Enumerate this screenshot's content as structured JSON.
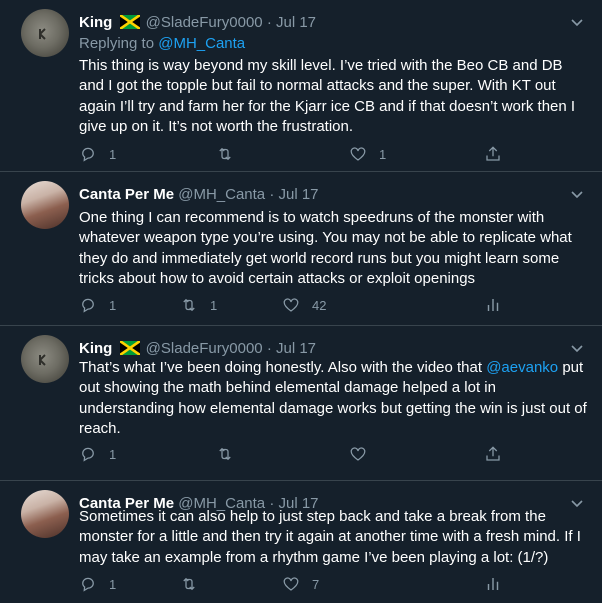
{
  "tweets": [
    {
      "name": "King",
      "handle": "@SladeFury0000",
      "dot": "·",
      "date": "Jul 17",
      "replying_prefix": "Replying to ",
      "replying_to": "@MH_Canta",
      "text": "This thing is way beyond my skill level. I’ve tried with the Beo CB and DB and I got the topple but fail to normal attacks and the super. With KT out again I’ll try and farm her for the Kjarr ice CB and if that doesn’t work then I give up on it. It’s not worth the frustration.",
      "replies": "1",
      "retweets": "",
      "likes": "1",
      "last_action": "share-icon"
    },
    {
      "name": "Canta Per Me",
      "handle": "@MH_Canta",
      "dot": "·",
      "date": "Jul 17",
      "text": "One thing I can recommend is to watch speedruns of the monster with whatever weapon type you’re using. You may not be able to replicate what they do and immediately get world record runs but you might learn some tricks about how to avoid certain attacks or exploit openings",
      "replies": "1",
      "retweets": "1",
      "likes": "42",
      "last_action": "analytics-icon"
    },
    {
      "name": "King",
      "handle": "@SladeFury0000",
      "dot": "·",
      "date": "Jul 17",
      "text_before": "That’s what I’ve been doing honestly. Also with the video that ",
      "mention": "@aevanko",
      "text_after": " put out showing the math behind elemental damage helped a lot in understanding how elemental damage works but getting the win is just out of reach.",
      "replies": "1",
      "retweets": "",
      "likes": "",
      "last_action": "share-icon"
    },
    {
      "name": "Canta Per Me",
      "handle": "@MH_Canta",
      "dot": "·",
      "date": "Jul 17",
      "text": "Sometimes it can also help to just step back and take a break from the monster for a little and then try it again at another time with a fresh mind. If I may take an example from a rhythm game I’ve been playing a lot: (1/?)",
      "replies": "1",
      "retweets": "",
      "likes": "7",
      "last_action": "analytics-icon"
    }
  ],
  "colors": {
    "background": "#15202b",
    "text": "#ffffff",
    "muted": "#8899a6",
    "accent": "#1da1f2",
    "border": "#38444d"
  }
}
